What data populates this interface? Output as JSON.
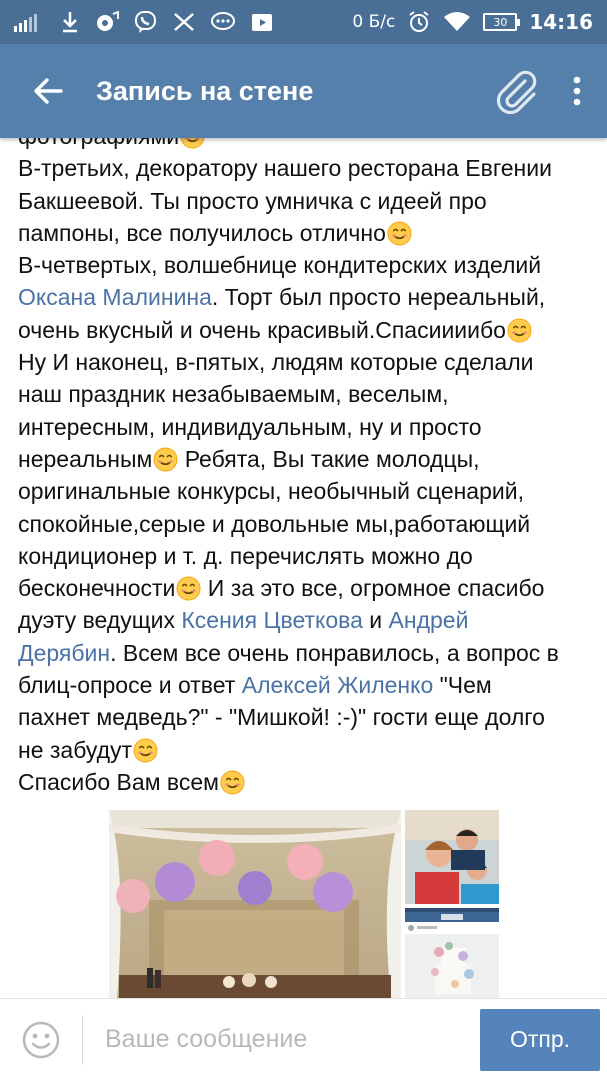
{
  "status_bar": {
    "net_speed": "0 Б/с",
    "battery": "30",
    "time": "14:16"
  },
  "header": {
    "title": "Запись на стене"
  },
  "post": {
    "lines": [
      [
        {
          "t": "фотографиями"
        },
        {
          "e": 1
        }
      ],
      [
        {
          "t": "В-третьих, декоратору нашего ресторана    Евгении"
        }
      ],
      [
        {
          "t": "Бакшеевой. Ты просто умничка с идеей про"
        }
      ],
      [
        {
          "t": "пампоны,  все получилось отлично"
        },
        {
          "e": 1
        }
      ],
      [
        {
          "t": "В-четвертых, волшебнице кондитерских изделий"
        }
      ],
      [
        {
          "m": "Оксана Малинина"
        },
        {
          "t": ". Торт был просто нереальный,"
        }
      ],
      [
        {
          "t": "очень вкусный и очень красивый.Спасиииибо"
        },
        {
          "e": 1
        }
      ],
      [
        {
          "t": "Ну И наконец, в-пятых, людям которые сделали"
        }
      ],
      [
        {
          "t": "наш праздник незабываемым, веселым,"
        }
      ],
      [
        {
          "t": "интересным, индивидуальным, ну и просто"
        }
      ],
      [
        {
          "t": "нереальным"
        },
        {
          "e": 1
        },
        {
          "t": " Ребята, Вы такие молодцы,"
        }
      ],
      [
        {
          "t": "оригинальные конкурсы, необычный сценарий,"
        }
      ],
      [
        {
          "t": "спокойные,серые и довольные  мы,работающий"
        }
      ],
      [
        {
          "t": "кондиционер и т. д. перечислять можно до"
        }
      ],
      [
        {
          "t": "бесконечности"
        },
        {
          "e": 1
        },
        {
          "t": " И за это все, огромное спасибо"
        }
      ],
      [
        {
          "t": "дуэту ведущих  "
        },
        {
          "m": "Ксения Цветкова"
        },
        {
          "t": " и  "
        },
        {
          "m": "Андрей"
        }
      ],
      [
        {
          "m": "Дерябин"
        },
        {
          "t": ". Всем все очень понравилось, а вопрос в"
        }
      ],
      [
        {
          "t": "блиц-опросе и ответ  "
        },
        {
          "m": "Алексей Жиленко"
        },
        {
          "t": " \"Чем"
        }
      ],
      [
        {
          "t": "пахнет медведь?\" - \"Мишкой! :-)\" гости еще долго"
        }
      ],
      [
        {
          "t": "не забудут"
        },
        {
          "e": 1
        }
      ],
      [
        {
          "t": "Спасибо Вам всем"
        },
        {
          "e": 1
        }
      ]
    ]
  },
  "photos": {
    "main": "photo-decorated-hall",
    "side_top": "photo-guests-selfie",
    "side_bottom": "photo-instagram-cake"
  },
  "composer": {
    "placeholder": "Ваше сообщение",
    "send_label": "Отпр."
  },
  "icons": {
    "back": "arrow-left-icon",
    "attach": "paperclip-icon",
    "more": "more-vert-icon",
    "smile": "smile-icon"
  },
  "colors": {
    "status_bar": "#4a6f96",
    "app_bar": "#5680ac",
    "mention": "#4a72a6",
    "send_button": "#5583bb"
  }
}
